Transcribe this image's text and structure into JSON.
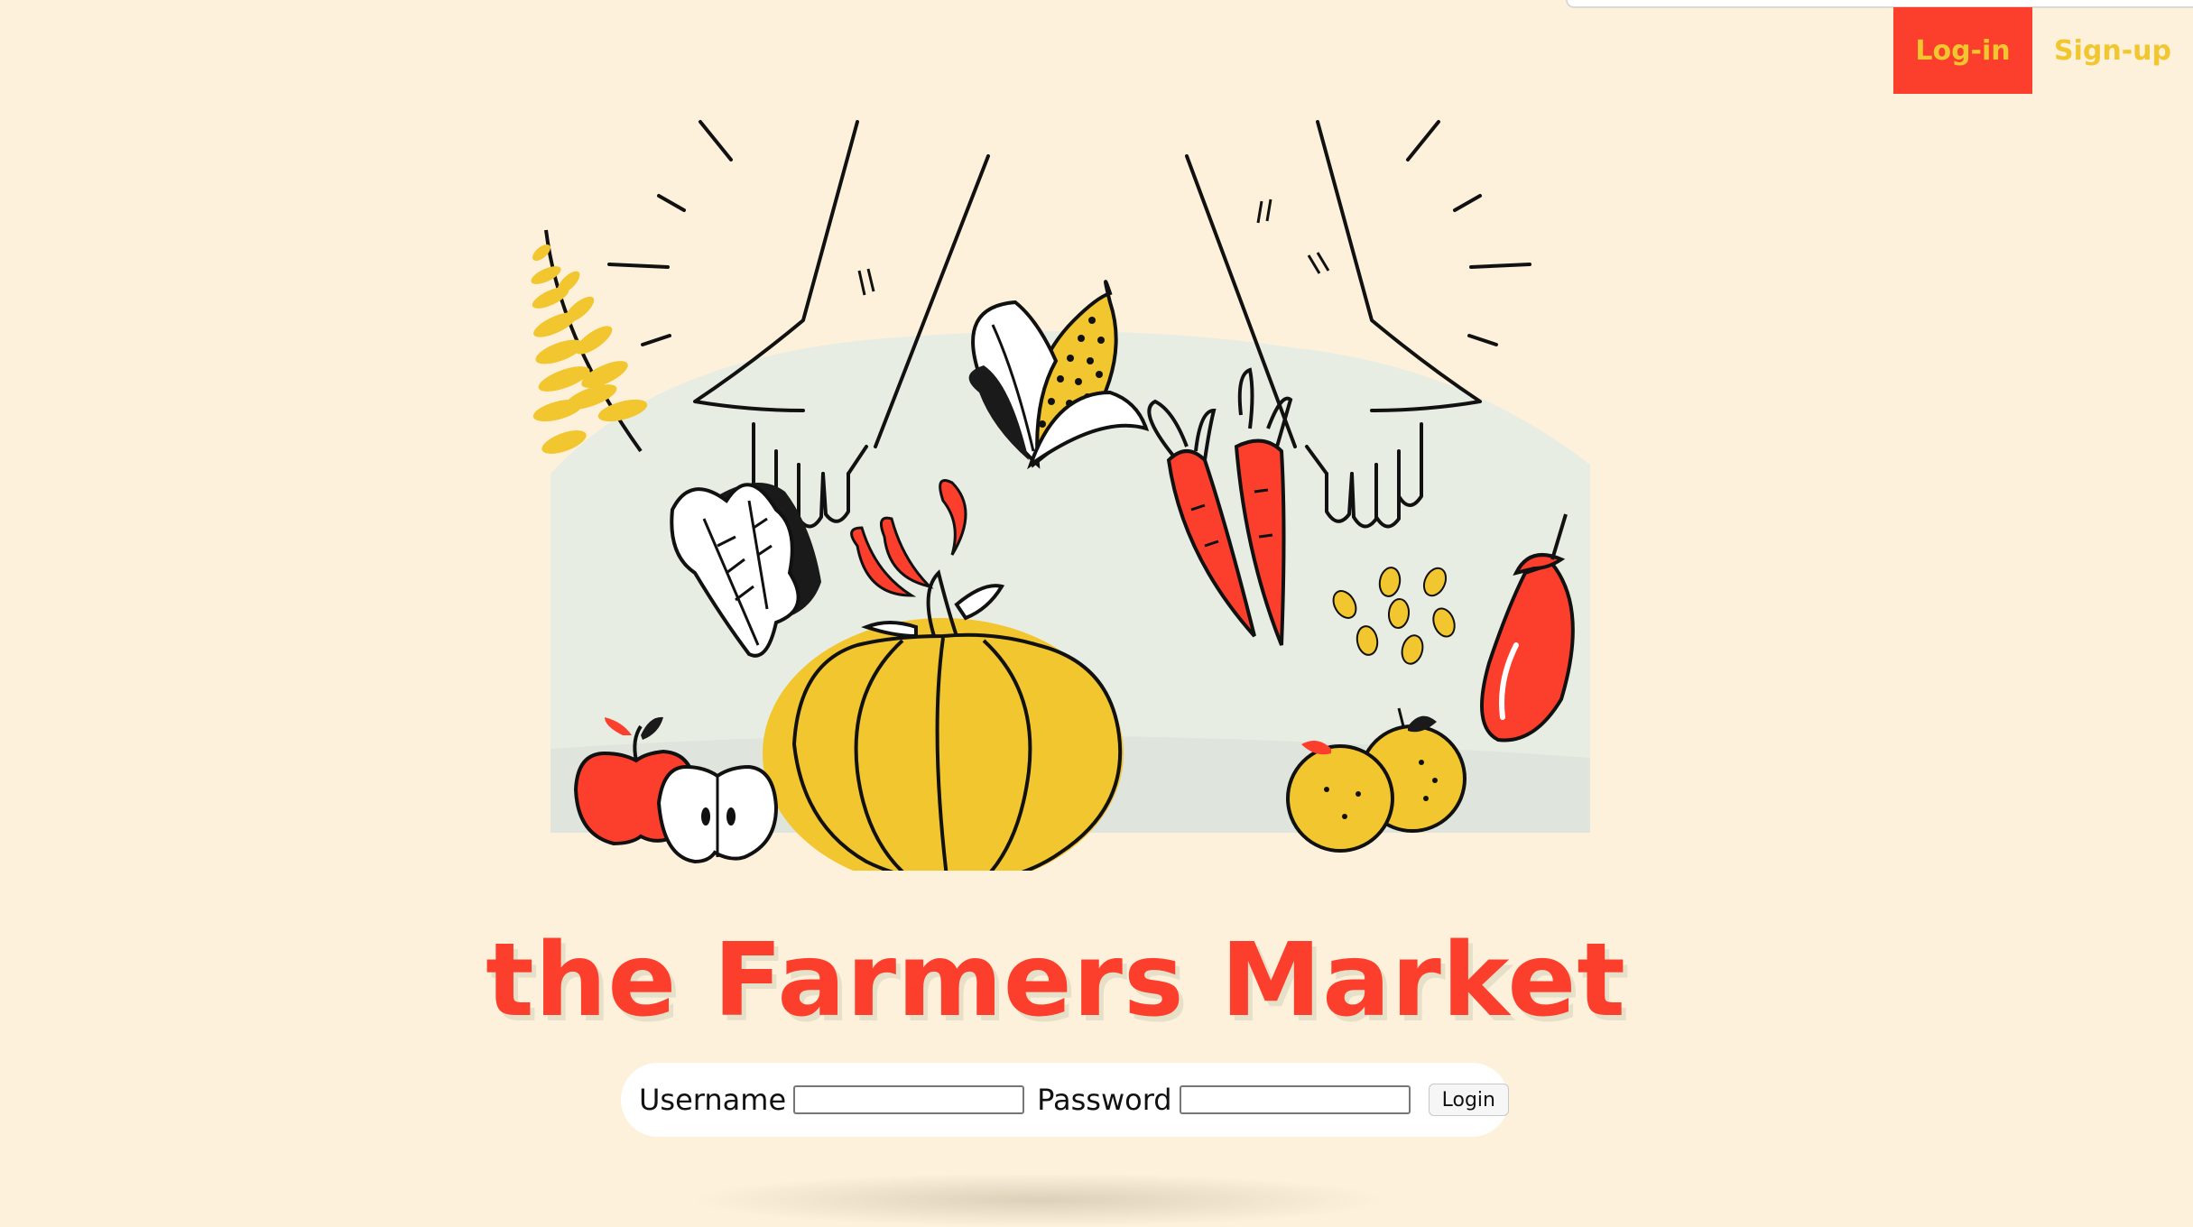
{
  "nav": {
    "login_label": "Log-in",
    "signup_label": "Sign-up"
  },
  "hero": {
    "illustration": "farmers-market-produce-illustration"
  },
  "title": "the Farmers Market",
  "login_form": {
    "username_label": "Username",
    "username_value": "",
    "password_label": "Password",
    "password_value": "",
    "submit_label": "Login"
  },
  "colors": {
    "background": "#fef1dc",
    "accent_red": "#fb3f2c",
    "accent_yellow": "#f2c62e",
    "panel": "#e6ebe2"
  }
}
